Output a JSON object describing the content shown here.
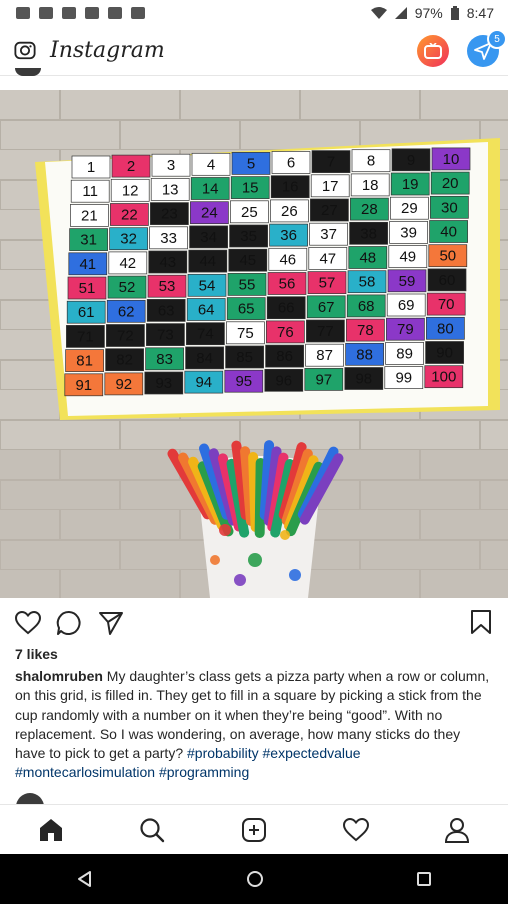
{
  "status_bar": {
    "battery": "97%",
    "time": "8:47"
  },
  "header": {
    "app_name": "Instagram",
    "dm_badge": "5"
  },
  "post": {
    "grid_numbers": [
      "1",
      "2",
      "3",
      "4",
      "5",
      "6",
      "7",
      "8",
      "9",
      "10",
      "11",
      "12",
      "13",
      "14",
      "15",
      "16",
      "17",
      "18",
      "19",
      "20",
      "21",
      "22",
      "23",
      "24",
      "25",
      "26",
      "27",
      "28",
      "29",
      "30",
      "31",
      "32",
      "33",
      "34",
      "35",
      "36",
      "37",
      "38",
      "39",
      "40",
      "41",
      "42",
      "43",
      "44",
      "45",
      "46",
      "47",
      "48",
      "49",
      "50",
      "51",
      "52",
      "53",
      "54",
      "55",
      "56",
      "57",
      "58",
      "59",
      "60",
      "61",
      "62",
      "63",
      "64",
      "65",
      "66",
      "67",
      "68",
      "69",
      "70",
      "71",
      "72",
      "73",
      "74",
      "75",
      "76",
      "77",
      "78",
      "79",
      "80",
      "81",
      "82",
      "83",
      "84",
      "85",
      "86",
      "87",
      "88",
      "89",
      "90",
      "91",
      "92",
      "93",
      "94",
      "95",
      "96",
      "97",
      "98",
      "99",
      "100"
    ],
    "likes": "7 likes",
    "username": "shalomruben",
    "caption_text": "My daughter’s class gets a pizza party when a row or column, on this grid, is filled in. They get to fill in a square by picking a stick from the cup randomly with a number on it when they’re being “good”. With no replacement. So I was wondering, on average, how many sticks do they have to pick to get a party?",
    "hashtags": [
      "#probability",
      "#expectedvalue",
      "#montecarlosimulation",
      "#programming"
    ]
  },
  "icons": {
    "like": "heart-icon",
    "comment": "comment-icon",
    "share": "send-icon",
    "save": "bookmark-icon",
    "home": "home-icon",
    "search": "search-icon",
    "new_post": "add-post-icon",
    "activity": "heart-icon",
    "profile": "profile-icon"
  }
}
